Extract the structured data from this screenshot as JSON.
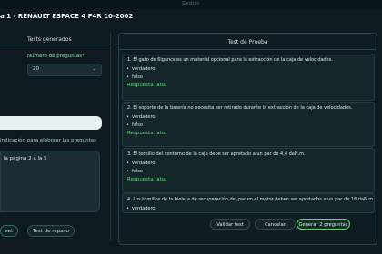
{
  "window": {
    "title": "Gestión"
  },
  "header": {
    "title": "a 1 -  RENAULT ESPACE 4 F4R 10-2002"
  },
  "left": {
    "tab_label": "Tests generados",
    "num_questions_label": "Número de preguntas*",
    "num_questions_value": "20",
    "search_value": "",
    "indication_label": "indicación para elaborar las preguntas",
    "indication_text": "la página 2 a la 5",
    "button1_label": "set",
    "button2_label": "Test de repaso"
  },
  "right": {
    "title": "Test de Prueba",
    "questions": [
      {
        "text": "1. El gato de 6igancs es un material opcional para la extracción de la caja de velocidades.",
        "options": [
          "verdadero",
          "falso"
        ],
        "answer": "Respuesta falso"
      },
      {
        "text": "2. El soporte de la batería no necesita ser retirado durante la extracción de la caja de velocidades.",
        "options": [
          "verdadero",
          "falso"
        ],
        "answer": "Respuesta falso"
      },
      {
        "text": "3. El tornillo del contorno de la caja debe ser apretado a un par de 4,4 daN.m.",
        "options": [
          "verdadero",
          "falso"
        ],
        "answer": "Respuesta falso"
      },
      {
        "text": "4. Los tornillos de la bieleta de recuperación del par en el motor deben ser apretados a un par de 18 daN.m.",
        "options": [
          "verdadero"
        ]
      }
    ],
    "buttons": {
      "validate": "Validar test",
      "cancel": "Cancelar",
      "generate": "Generar 2 preguntas"
    }
  }
}
